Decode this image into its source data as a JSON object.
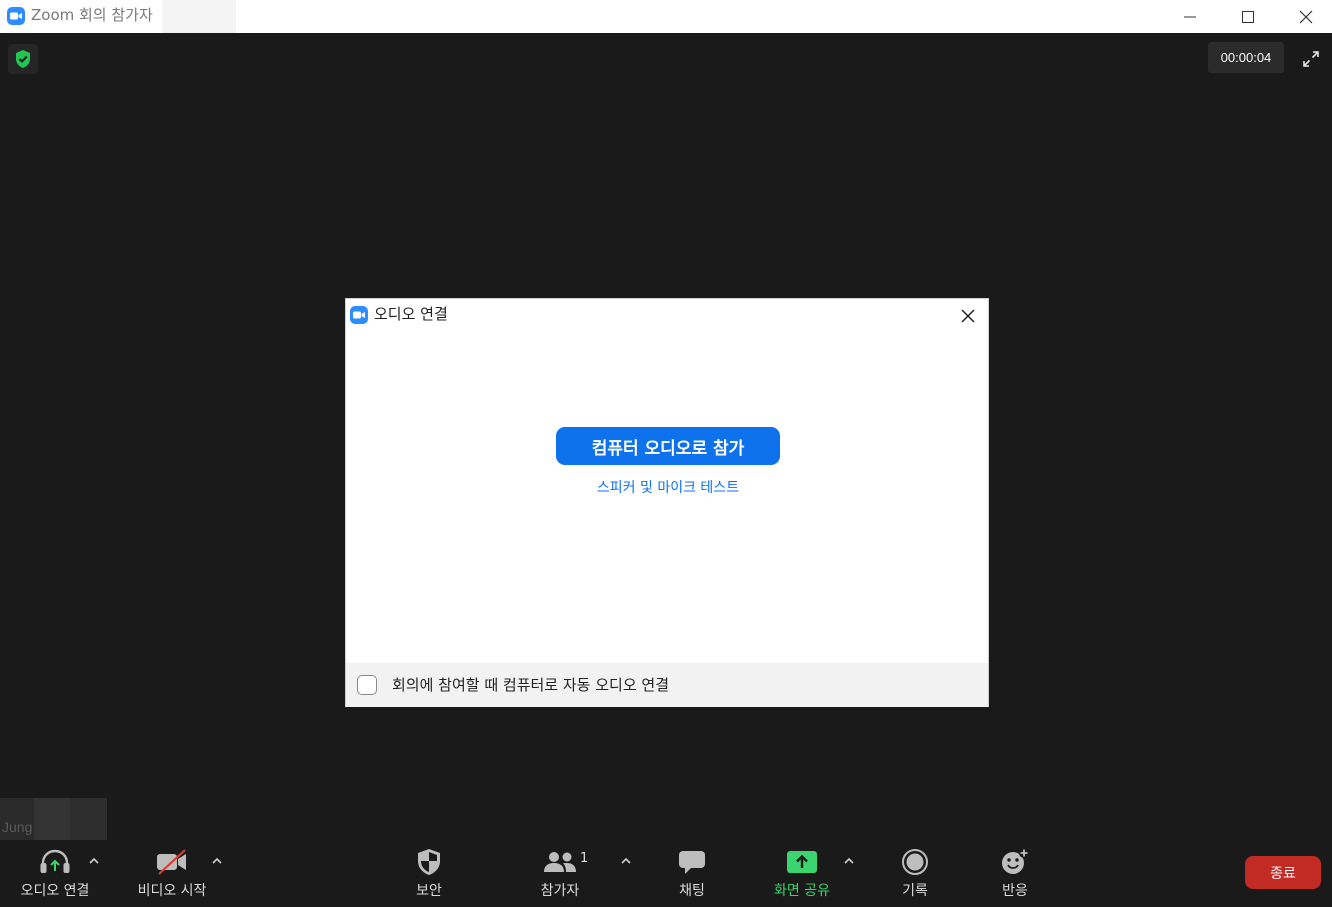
{
  "window": {
    "title": "Zoom 회의 참가자"
  },
  "meeting": {
    "timer": "00:00:04",
    "self_name": "Jung"
  },
  "dialog": {
    "title": "오디오 연결",
    "join_button": "컴퓨터 오디오로 참가",
    "test_link": "스피커 및 마이크 테스트",
    "auto_connect_label": "회의에 참여할 때 컴퓨터로 자동 오디오 연결",
    "auto_connect_checked": false
  },
  "toolbar": {
    "audio": "오디오 연결",
    "video": "비디오 시작",
    "security": "보안",
    "participants": "참가자",
    "participants_count": "1",
    "chat": "채팅",
    "share": "화면 공유",
    "record": "기록",
    "reactions": "반응",
    "end": "종료"
  },
  "colors": {
    "accent_blue": "#0e72ed",
    "share_green": "#3bd46e",
    "end_red": "#c22a24",
    "background": "#1a1a1a"
  },
  "icons": [
    "zoom-logo-icon",
    "minimize-icon",
    "maximize-icon",
    "close-icon",
    "shield-check-icon",
    "fullscreen-icon",
    "headphones-icon",
    "video-off-icon",
    "chevron-up-icon",
    "security-shield-icon",
    "participants-icon",
    "chat-bubble-icon",
    "share-screen-icon",
    "record-icon",
    "reaction-icon"
  ]
}
